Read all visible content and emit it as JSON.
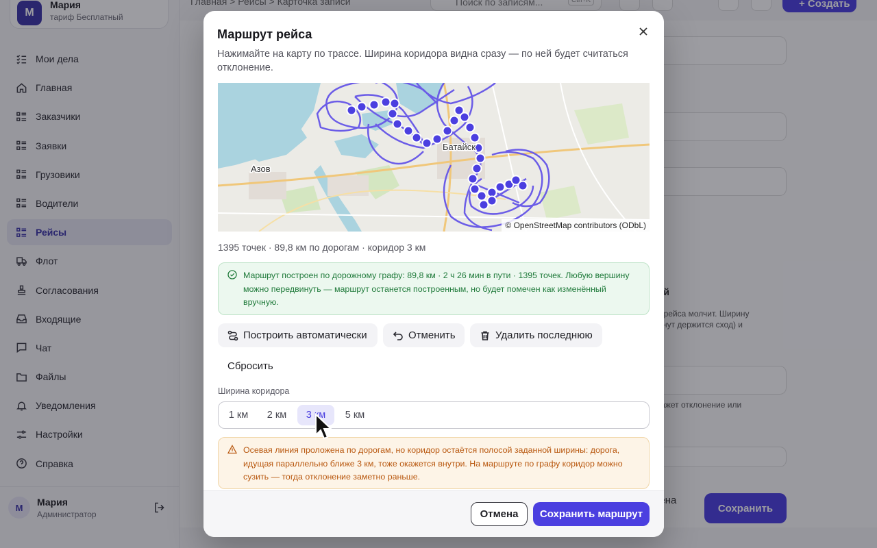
{
  "account": {
    "initial": "М",
    "name": "Мария",
    "plan": "тариф Бесплатный"
  },
  "nav": [
    {
      "label": "Мои дела",
      "icon": "tasks-icon"
    },
    {
      "label": "Главная",
      "icon": "home-icon"
    },
    {
      "label": "Заказчики",
      "icon": "list-icon"
    },
    {
      "label": "Заявки",
      "icon": "list-icon"
    },
    {
      "label": "Грузовики",
      "icon": "list-icon"
    },
    {
      "label": "Водители",
      "icon": "list-icon"
    },
    {
      "label": "Рейсы",
      "icon": "list-icon",
      "active": true
    },
    {
      "label": "Флот",
      "icon": "truck-icon"
    },
    {
      "label": "Согласования",
      "icon": "stamp-icon"
    },
    {
      "label": "Входящие",
      "icon": "inbox-icon"
    },
    {
      "label": "Чат",
      "icon": "chat-icon"
    },
    {
      "label": "Файлы",
      "icon": "folder-icon"
    },
    {
      "label": "Уведомления",
      "icon": "bell-icon"
    },
    {
      "label": "Настройки",
      "icon": "sliders-icon"
    },
    {
      "label": "Справка",
      "icon": "help-icon"
    }
  ],
  "user": {
    "initial": "М",
    "name": "Мария",
    "role": "Администратор"
  },
  "topbar": {
    "breadcrumb": "Главная   >   Рейсы   >   Карточка записи",
    "search_placeholder": "Поиск по записям...",
    "search_shortcut": "Ctrl+K",
    "create_label": "+ Создать"
  },
  "background": {
    "section_title": "сий",
    "section_text": "ль рейса молчит. Ширину\nминут держится сход) и",
    "field_hint": "окажет отклонение или",
    "cancel_label": "мена",
    "save_label": "Сохранить"
  },
  "modal": {
    "title": "Маршрут рейса",
    "description": "Нажимайте на карту по трассе. Ширина коридора видна сразу — по ней будет считаться отклонение.",
    "map": {
      "labels": {
        "azov": "Азов",
        "bataysk": "Батайск"
      },
      "credit": "© OpenStreetMap contributors (ODbL)",
      "route_color": "#6b5ce7",
      "vertex_color": "#4b3fe0"
    },
    "stats": "1395 точек · 89,8 км по дорогам · коридор 3 км",
    "success_alert": "Маршрут построен по дорожному графу: 89,8 км · 2 ч 26 мин в пути · 1395 точек. Любую вершину можно передвинуть — маршрут останется построенным, но будет помечен как изменённый вручную.",
    "actions": {
      "auto_build": "Построить автоматически",
      "undo": "Отменить",
      "delete_last": "Удалить последнюю",
      "reset": "Сбросить"
    },
    "corridor": {
      "label": "Ширина коридора",
      "options": [
        "1 км",
        "2 км",
        "3 км",
        "5 км"
      ],
      "selected": "3 км"
    },
    "warning_alert": "Осевая линия проложена по дорогам, но коридор остаётся полосой заданной ширины: дорога, идущая параллельно ближе 3 км, тоже окажется внутри. На маршруте по графу коридор можно сузить — тогда отклонение заметно раньше.",
    "footer": {
      "cancel": "Отмена",
      "save": "Сохранить маршрут"
    }
  }
}
